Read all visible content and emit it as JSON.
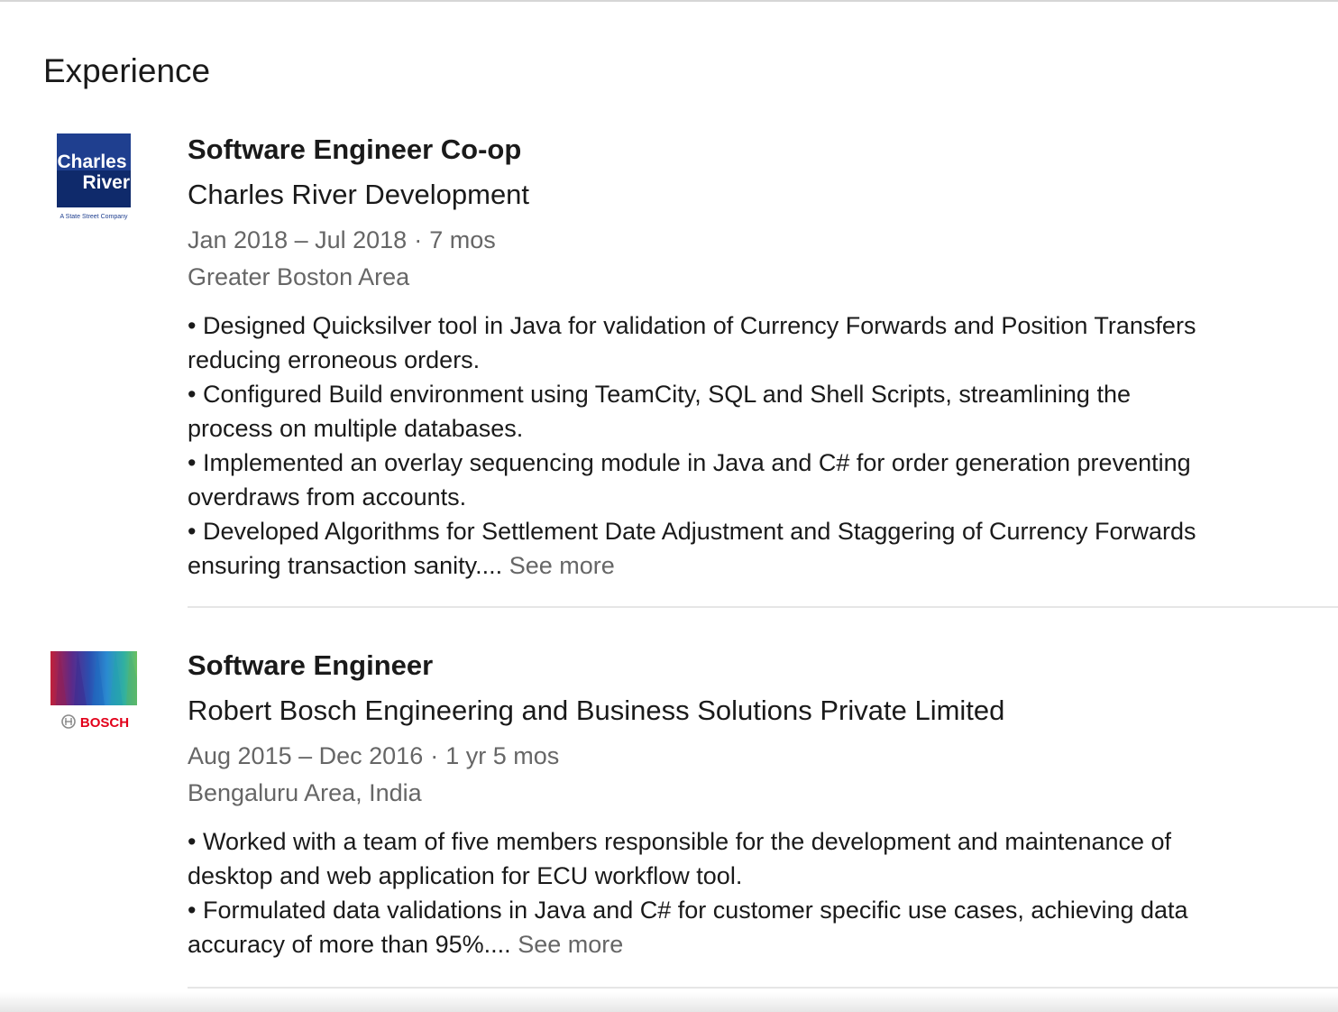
{
  "section": {
    "title": "Experience"
  },
  "experiences": [
    {
      "title": "Software Engineer Co-op",
      "company": "Charles River Development",
      "dates": "Jan 2018 – Jul 2018",
      "separator": "·",
      "duration": "7 mos",
      "location": "Greater Boston Area",
      "logo": {
        "line1": "Charles",
        "line2": "River",
        "tagline": "A State Street Company",
        "color": "#1f3f8f"
      },
      "description": [
        "• Designed Quicksilver tool in Java for validation of Currency Forwards and Position Transfers",
        "reducing erroneous orders.",
        "• Configured Build environment using TeamCity, SQL and Shell Scripts, streamlining the",
        "process on multiple databases.",
        "• Implemented an overlay sequencing module in Java and C# for order generation preventing",
        "overdraws from accounts.",
        "• Developed Algorithms for Settlement Date Adjustment and Staggering of Currency Forwards",
        "ensuring transaction sanity...."
      ],
      "see_more": "See more"
    },
    {
      "title": "Software Engineer",
      "company": "Robert Bosch Engineering and Business Solutions Private Limited",
      "dates": "Aug 2015 – Dec 2016",
      "separator": "·",
      "duration": "1 yr 5 mos",
      "location": "Bengaluru Area, India",
      "logo": {
        "text": "BOSCH",
        "color": "#e2001a"
      },
      "description": [
        "• Worked with a team of five members responsible for the development and maintenance of",
        "desktop and web application for ECU workflow tool.",
        "• Formulated data validations in Java and C# for customer specific use cases, achieving data",
        "accuracy of more than 95%...."
      ],
      "see_more": "See more"
    }
  ]
}
